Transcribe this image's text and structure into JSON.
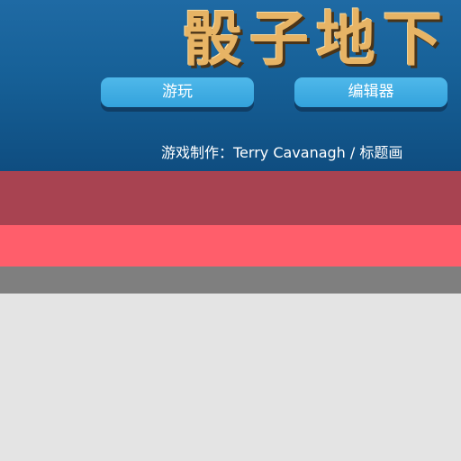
{
  "title_screen": {
    "game_title": "骰子地下",
    "buttons": {
      "play_label": "游玩",
      "editor_label": "编辑器"
    },
    "credits": "游戏制作：Terry Cavanagh / 标题画"
  },
  "colors": {
    "panel": "#166097",
    "title_text": "#e7b465",
    "button": "#3aa8e0",
    "band_dark": "#a84351",
    "band_bright": "#ff5e6b",
    "band_grey": "#7f7f7f",
    "ground": "#e4e4e4"
  }
}
